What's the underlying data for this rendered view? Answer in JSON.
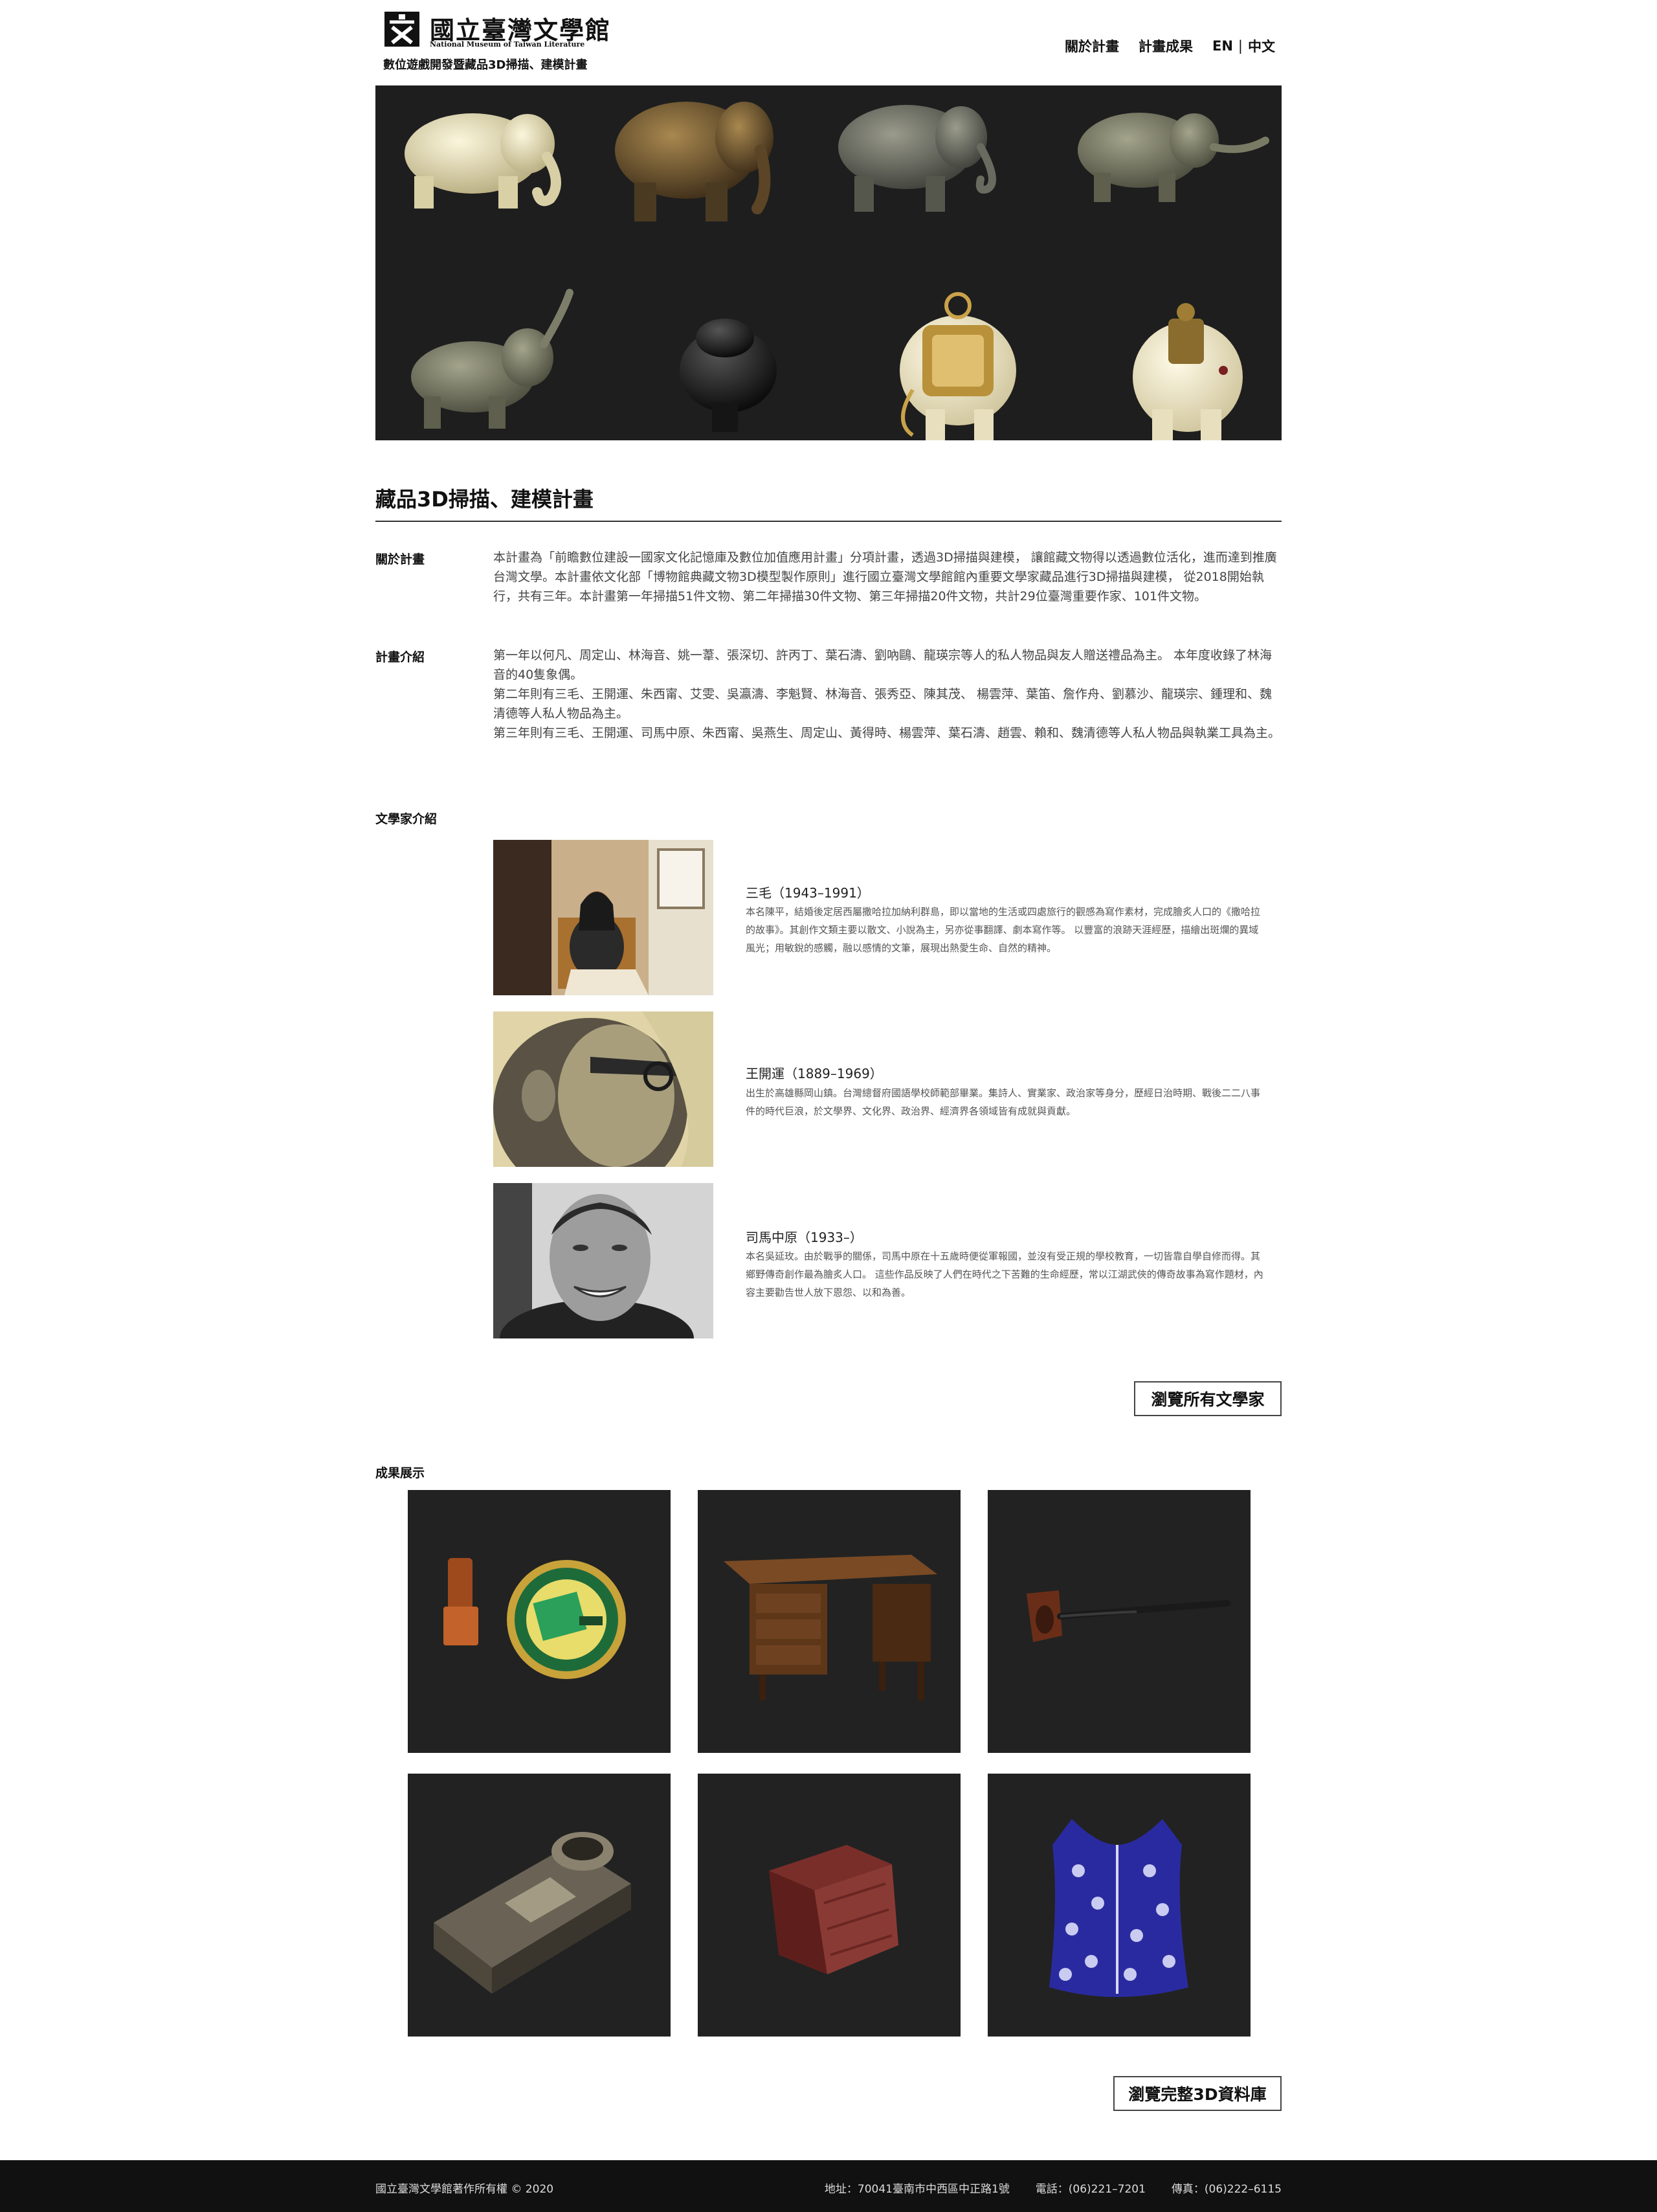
{
  "header": {
    "logo_cn": "國立臺灣文學館",
    "logo_en": "National Museum of Taiwan Literature",
    "subtitle": "數位遊戲開發暨藏品3D掃描、建模計畫",
    "nav": {
      "about": "關於計畫",
      "results": "計畫成果",
      "lang_en": "EN",
      "lang_sep": "|",
      "lang_zh": "中文"
    }
  },
  "intro": {
    "title": "藏品3D掃描、建模計畫",
    "about_label": "關於計畫",
    "about_text": "本計畫為「前瞻數位建設一國家文化記憶庫及數位加值應用計畫」分項計畫，透過3D掃描與建模， 讓館藏文物得以透過數位活化，進而達到推廣台灣文學。本計畫依文化部「博物館典藏文物3D模型製作原則」進行國立臺灣文學館館內重要文學家藏品進行3D掃描與建模， 從2018開始執行，共有三年。本計畫第一年掃描51件文物、第二年掃描30件文物、第三年掃描20件文物，共計29位臺灣重要作家、101件文物。",
    "plan_label": "計畫介紹",
    "plan_text_1": "第一年以何凡、周定山、林海音、姚一葦、張深切、許丙丁、葉石濤、劉吶鷗、龍瑛宗等人的私人物品與友人贈送禮品為主。 本年度收錄了林海音的40隻象偶。",
    "plan_text_2": "第二年則有三毛、王開運、朱西甯、艾雯、吳瀛濤、李魁賢、林海音、張秀亞、陳其茂、 楊雲萍、葉笛、詹作舟、劉慕沙、龍瑛宗、鍾理和、魏清德等人私人物品為主。",
    "plan_text_3": "第三年則有三毛、王開運、司馬中原、朱西甯、吳燕生、周定山、黃得時、楊雲萍、葉石濤、趙雲、賴和、魏清德等人私人物品與執業工具為主。"
  },
  "writers": {
    "label": "文學家介紹",
    "items": [
      {
        "name": "三毛（1943–1991）",
        "desc": "本名陳平，結婚後定居西屬撒哈拉加納利群島，即以當地的生活或四處旅行的觀感為寫作素材，完成膾炙人口的《撒哈拉的故事》。其創作文類主要以散文、小說為主，另亦從事翻譯、劇本寫作等。 以豐富的浪跡天涯經歷，描繪出斑爛的異域風光；用敏銳的感觸，融以感情的文筆，展現出熱愛生命、自然的精神。"
      },
      {
        "name": "王開運（1889–1969）",
        "desc": "出生於高雄縣岡山鎮。台灣總督府國語學校師範部畢業。集詩人、實業家、政治家等身分，歷經日治時期、戰後二二八事件的時代巨浪，於文學界、文化界、政治界、經濟界各領域皆有成就與貢獻。"
      },
      {
        "name": "司馬中原（1933–）",
        "desc": "本名吳延玫。由於戰爭的關係，司馬中原在十五歲時便從軍報國，並沒有受正規的學校教育，一切皆靠自學自修而得。其鄉野傳奇創作最為膾炙人口。 這些作品反映了人們在時代之下苦難的生命經歷，常以江湖武俠的傳奇故事為寫作題材，內容主要勸告世人放下恩怨、以和為善。"
      }
    ],
    "browse_button": "瀏覽所有文學家"
  },
  "gallery": {
    "label": "成果展示",
    "items": [
      "seal-and-tin",
      "writing-desk",
      "tobacco-pipe",
      "ornate-inkstand",
      "lacquer-box",
      "blue-vest"
    ],
    "browse_button": "瀏覽完整3D資料庫"
  },
  "footer": {
    "copyright": "國立臺灣文學館著作所有權 © 2020",
    "address": "地址：70041臺南市中西區中正路1號",
    "phone": "電話：(06)221–7201",
    "fax": "傳真：(06)222–6115"
  },
  "colors": {
    "hero_bg": "#1e1e1e",
    "tile_bg": "#222222",
    "footer_bg": "#111111",
    "text": "#222222"
  }
}
